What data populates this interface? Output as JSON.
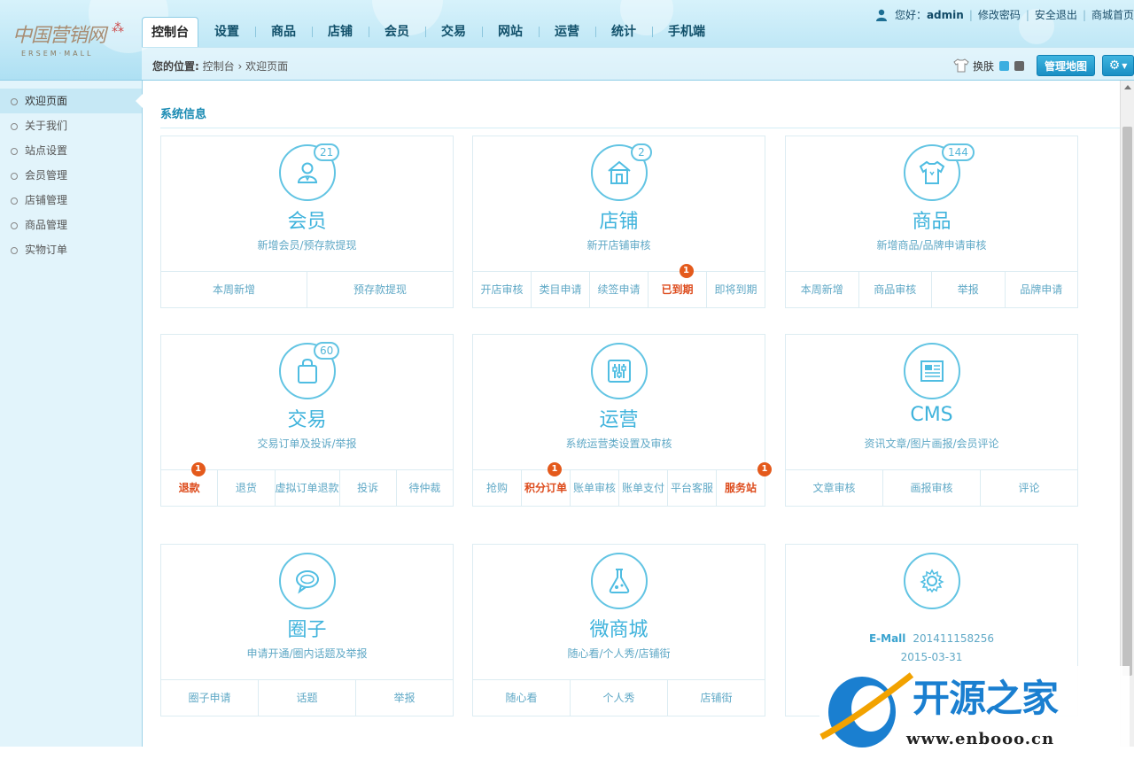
{
  "logo": {
    "text": "中国营销网",
    "subtext": "ERSEM·MALL"
  },
  "header": {
    "tabs": [
      "控制台",
      "设置",
      "商品",
      "店铺",
      "会员",
      "交易",
      "网站",
      "运营",
      "统计",
      "手机端"
    ],
    "user": {
      "greeting": "您好：",
      "name": "admin"
    },
    "links": [
      "修改密码",
      "安全退出",
      "商城首页"
    ]
  },
  "breadcrumb": {
    "label": "您的位置:",
    "path": "控制台",
    "sep": "›",
    "current": "欢迎页面"
  },
  "tools": {
    "skin_label": "换肤",
    "skin_colors": [
      "#3aaee0",
      "#666666"
    ],
    "map_button": "管理地图"
  },
  "sidebar": {
    "items": [
      "欢迎页面",
      "关于我们",
      "站点设置",
      "会员管理",
      "店铺管理",
      "商品管理",
      "实物订单"
    ]
  },
  "main": {
    "section_title": "系统信息"
  },
  "cards": [
    {
      "title": "会员",
      "count": "21",
      "desc": "新增会员/预存款提现",
      "icon": "user-icon",
      "links": [
        {
          "label": "本周新增"
        },
        {
          "label": "预存款提现"
        }
      ]
    },
    {
      "title": "店铺",
      "count": "2",
      "desc": "新开店铺审核",
      "icon": "store-icon",
      "links": [
        {
          "label": "开店审核"
        },
        {
          "label": "类目申请"
        },
        {
          "label": "续签申请"
        },
        {
          "label": "已到期",
          "hot": true,
          "badge": "1"
        },
        {
          "label": "即将到期"
        }
      ]
    },
    {
      "title": "商品",
      "count": "144",
      "desc": "新增商品/品牌申请审核",
      "icon": "shirt-icon",
      "links": [
        {
          "label": "本周新增"
        },
        {
          "label": "商品审核"
        },
        {
          "label": "举报"
        },
        {
          "label": "品牌申请"
        }
      ]
    },
    {
      "title": "交易",
      "count": "60",
      "desc": "交易订单及投诉/举报",
      "icon": "bag-icon",
      "links": [
        {
          "label": "退款",
          "hot": true,
          "badge": "1"
        },
        {
          "label": "退货"
        },
        {
          "label": "虚拟订单退款"
        },
        {
          "label": "投诉"
        },
        {
          "label": "待仲裁"
        }
      ]
    },
    {
      "title": "运营",
      "count": "",
      "desc": "系统运营类设置及审核",
      "icon": "sliders-icon",
      "links": [
        {
          "label": "抢购"
        },
        {
          "label": "积分订单",
          "hot": true,
          "badge": "1"
        },
        {
          "label": "账单审核"
        },
        {
          "label": "账单支付"
        },
        {
          "label": "平台客服"
        },
        {
          "label": "服务站",
          "hot": true,
          "badge": "1"
        }
      ]
    },
    {
      "title": "CMS",
      "count": "",
      "desc": "资讯文章/图片画报/会员评论",
      "icon": "document-icon",
      "links": [
        {
          "label": "文章审核"
        },
        {
          "label": "画报审核"
        },
        {
          "label": "评论"
        }
      ]
    },
    {
      "title": "圈子",
      "count": "",
      "desc": "申请开通/圈内话题及举报",
      "icon": "chat-icon",
      "links": [
        {
          "label": "圈子申请"
        },
        {
          "label": "话题"
        },
        {
          "label": "举报"
        }
      ]
    },
    {
      "title": "微商城",
      "count": "",
      "desc": "随心看/个人秀/店铺街",
      "icon": "flask-icon",
      "links": [
        {
          "label": "随心看"
        },
        {
          "label": "个人秀"
        },
        {
          "label": "店铺街"
        }
      ]
    }
  ],
  "version_card": {
    "icon": "gear-icon",
    "product": "E-Mall",
    "version": "201411158256",
    "date": "2015-03-31"
  },
  "watermark": {
    "text": "开源之家",
    "url": "www.enbooo.cn"
  }
}
